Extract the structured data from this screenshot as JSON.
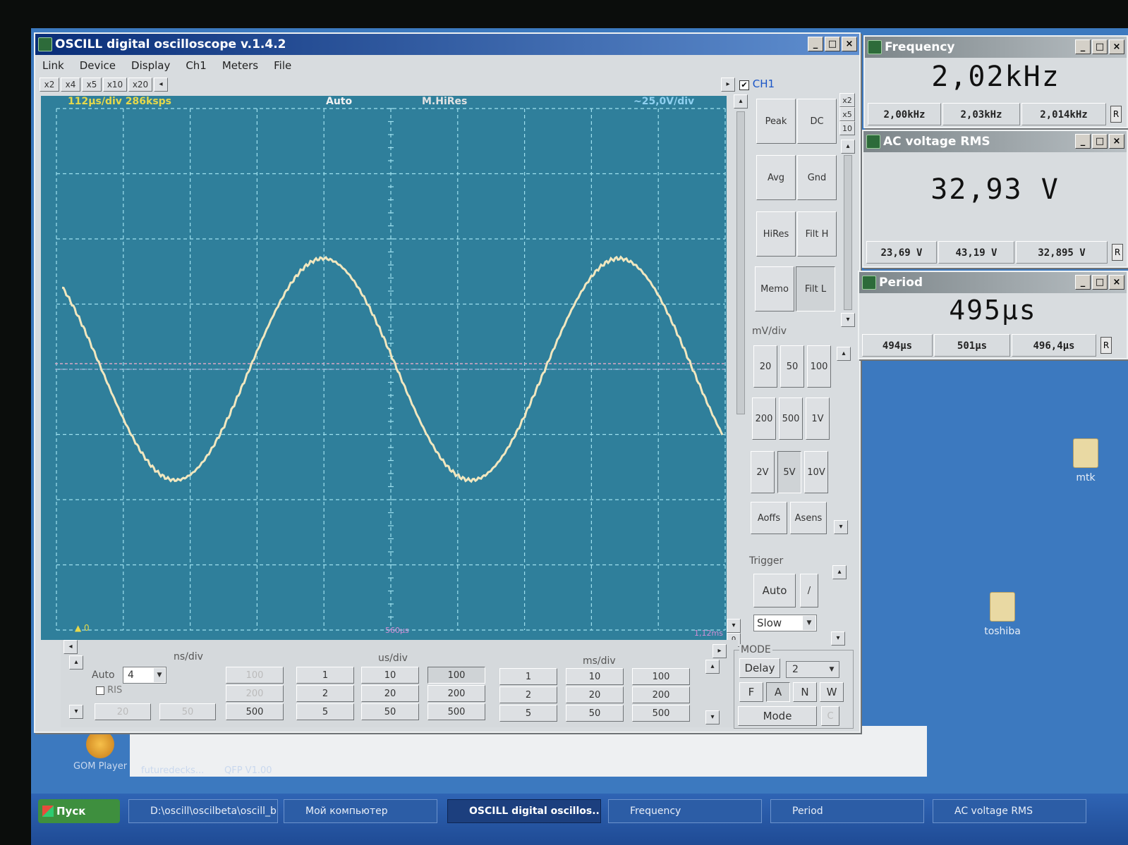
{
  "main_window": {
    "title": "OSCILL digital oscilloscope v.1.4.2",
    "menu": [
      "Link",
      "Device",
      "Display",
      "Ch1",
      "Meters",
      "File"
    ],
    "zoom_buttons": [
      "x2",
      "x4",
      "x5",
      "x10",
      "x20"
    ],
    "channel_label": "CH1",
    "channel_checked": true,
    "side_zoom": [
      "x2",
      "x5",
      "10"
    ]
  },
  "scope": {
    "timebase": "112μs/div",
    "sample_rate": "286ksps",
    "trigger_mode": "Auto",
    "acquire_mode": "M.HiRes",
    "volts_per_div": "~25,0V/div",
    "cursor_time": "560μs",
    "end_time": "1,12ms",
    "ground_marker": "0",
    "grid_cols": 10,
    "grid_rows": 8,
    "waveform": {
      "type": "sine",
      "frequency_khz": 2.02,
      "amplitude_div": 1.7,
      "offset_div": 0.45,
      "phase_deg": 125
    }
  },
  "coupling_buttons": {
    "row1": [
      "Peak",
      "DC"
    ],
    "row2": [
      "Avg",
      "Gnd"
    ],
    "row3": [
      "HiRes",
      "Filt H"
    ],
    "row4": [
      "Memo",
      "Filt L"
    ]
  },
  "volt_div": {
    "label": "mV/div",
    "row1": [
      "20",
      "50",
      "100"
    ],
    "row2": [
      "200",
      "500",
      "1V"
    ],
    "row3": [
      "2V",
      "5V",
      "10V"
    ],
    "selected": "5V",
    "row4": [
      "Aoffs",
      "Asens"
    ]
  },
  "trigger": {
    "label": "Trigger",
    "mode": "Auto",
    "edge": "/",
    "speed": "Slow"
  },
  "time_div": {
    "ns_label": "ns/div",
    "us_label": "us/div",
    "ms_label": "ms/div",
    "auto_label": "Auto",
    "auto_value": "4",
    "ris_label": "RIS",
    "ns_values": [
      "100",
      "200",
      "500"
    ],
    "ns_disabled": [
      "20",
      "50"
    ],
    "us_values": [
      [
        "1",
        "10",
        "100"
      ],
      [
        "2",
        "20",
        "200"
      ],
      [
        "5",
        "50",
        "500"
      ]
    ],
    "ms_values": [
      [
        "1",
        "10",
        "100"
      ],
      [
        "2",
        "20",
        "200"
      ],
      [
        "5",
        "50",
        "500"
      ]
    ],
    "selected": "100 us"
  },
  "mode": {
    "label": "MODE",
    "delay": "Delay",
    "delay_value": "2",
    "buttons": [
      "F",
      "A",
      "N",
      "W"
    ],
    "mode_button": "Mode",
    "c_label": "C"
  },
  "frequency_meter": {
    "title": "Frequency",
    "value": "2,02kHz",
    "min": "2,00kHz",
    "max": "2,03kHz",
    "avg": "2,014kHz",
    "r": "R"
  },
  "voltage_meter": {
    "title": "AC voltage RMS",
    "value": "32,93 V",
    "min": "23,69 V",
    "max": "43,19 V",
    "avg": "32,895 V",
    "r": "R"
  },
  "period_meter": {
    "title": "Period",
    "value": "495μs",
    "min": "494μs",
    "max": "501μs",
    "avg": "496,4μs",
    "r": "R"
  },
  "desktop": {
    "icons": [
      "mtk",
      "toshiba"
    ],
    "gom_label": "GOM Player",
    "strip": [
      "futuredecks...",
      "QFP V1.00"
    ]
  },
  "taskbar": {
    "start": "Пуск",
    "items": [
      "D:\\oscill\\oscilbeta\\oscill_b...",
      "Мой компьютер",
      "OSCILL digital oscillos...",
      "Frequency",
      "Period",
      "AC voltage RMS"
    ]
  },
  "colors": {
    "scope_bg": "#2f7f9b",
    "grid": "#9ee0ee",
    "trace": "#f1e7bf",
    "title_active": "#0a2e78"
  }
}
